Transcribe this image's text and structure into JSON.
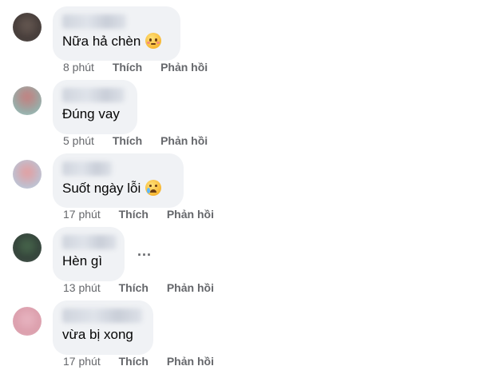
{
  "comments": [
    {
      "text": "Nữa hả chèn",
      "emoji_icon": "flushed-face-icon",
      "time": "8 phút",
      "like_label": "Thích",
      "reply_label": "Phản hồi"
    },
    {
      "text": "Đúng vay",
      "time": "5 phút",
      "like_label": "Thích",
      "reply_label": "Phản hồi"
    },
    {
      "text": "Suốt ngày lỗi",
      "emoji_icon": "crying-face-icon",
      "time": "17 phút",
      "like_label": "Thích",
      "reply_label": "Phản hồi"
    },
    {
      "text": "Hèn gì",
      "more_options": "...",
      "time": "13 phút",
      "like_label": "Thích",
      "reply_label": "Phản hồi"
    },
    {
      "text": "vừa bị xong",
      "time": "17 phút",
      "like_label": "Thích",
      "reply_label": "Phản hồi"
    }
  ],
  "colors": {
    "bubble": "#f0f2f5",
    "meta_text": "#65676b",
    "comment_text": "#050505"
  }
}
